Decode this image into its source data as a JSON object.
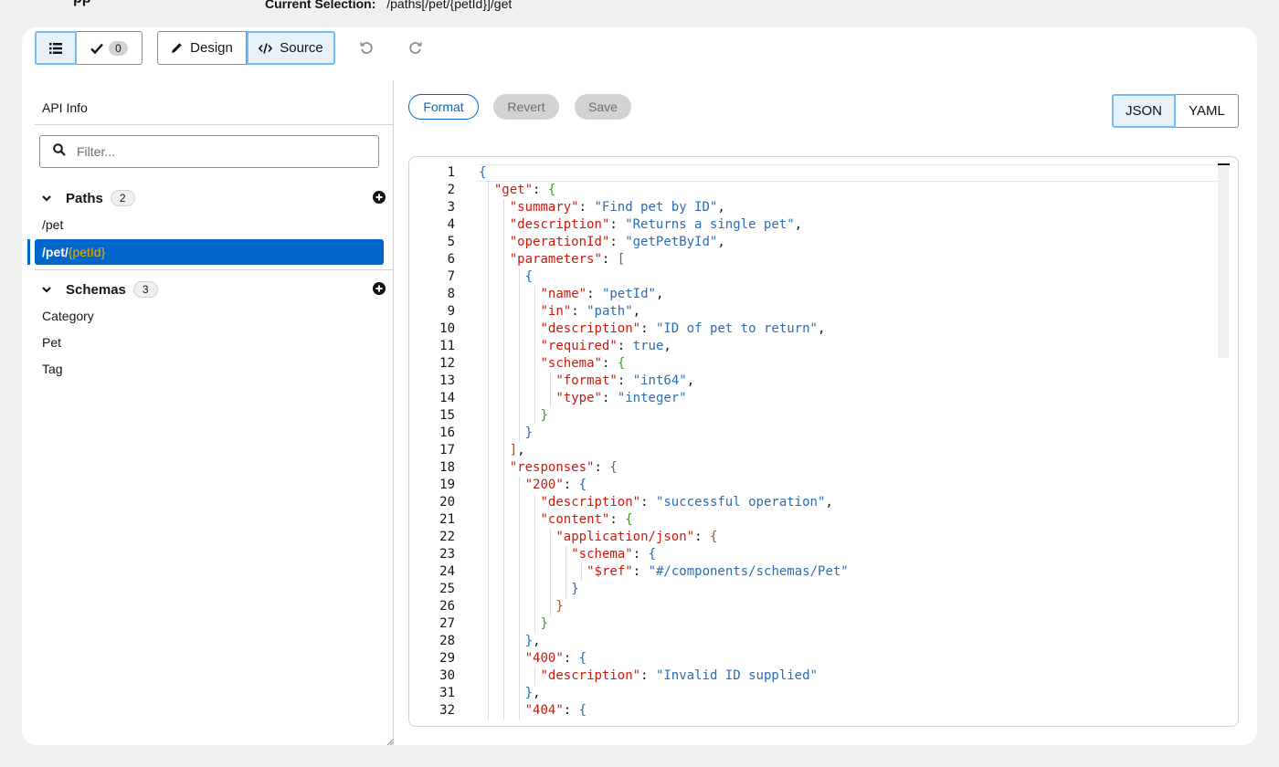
{
  "header": {
    "fragment": "pp",
    "current_selection_label": "Current Selection:",
    "current_selection_value": "/paths[/pet/{petId}]/get"
  },
  "toolbar": {
    "list_view_icon": "list-icon",
    "validation_count": "0",
    "design_label": "Design",
    "source_label": "Source",
    "undo_icon": "undo-icon",
    "redo_icon": "redo-icon"
  },
  "sidebar": {
    "api_info": "API Info",
    "filter_placeholder": "Filter...",
    "paths": {
      "title": "Paths",
      "count": "2",
      "items": [
        "/pet"
      ],
      "selected_prefix": "/pet/",
      "selected_param": "{petId}"
    },
    "schemas": {
      "title": "Schemas",
      "count": "3",
      "items": [
        "Category",
        "Pet",
        "Tag"
      ]
    }
  },
  "editor_toolbar": {
    "format_label": "Format",
    "revert_label": "Revert",
    "save_label": "Save",
    "json_label": "JSON",
    "yaml_label": "YAML",
    "active_format": "JSON"
  },
  "editor": {
    "line_numbers": [
      "1",
      "2",
      "3",
      "4",
      "5",
      "6",
      "7",
      "8",
      "9",
      "10",
      "11",
      "12",
      "13",
      "14",
      "15",
      "16",
      "17",
      "18",
      "19",
      "20",
      "21",
      "22",
      "23",
      "24",
      "25",
      "26",
      "27",
      "28",
      "29",
      "30",
      "31",
      "32"
    ],
    "lines": [
      "{",
      "  \"get\": {",
      "    \"summary\": \"Find pet by ID\",",
      "    \"description\": \"Returns a single pet\",",
      "    \"operationId\": \"getPetById\",",
      "    \"parameters\": [",
      "      {",
      "        \"name\": \"petId\",",
      "        \"in\": \"path\",",
      "        \"description\": \"ID of pet to return\",",
      "        \"required\": true,",
      "        \"schema\": {",
      "          \"format\": \"int64\",",
      "          \"type\": \"integer\"",
      "        }",
      "      }",
      "    ],",
      "    \"responses\": {",
      "      \"200\": {",
      "        \"description\": \"successful operation\",",
      "        \"content\": {",
      "          \"application/json\": {",
      "            \"schema\": {",
      "              \"$ref\": \"#/components/schemas/Pet\"",
      "            }",
      "          }",
      "        }",
      "      },",
      "      \"400\": {",
      "        \"description\": \"Invalid ID supplied\"",
      "      },",
      "      \"404\": {"
    ]
  },
  "colors": {
    "accent": "#0066cc",
    "key": "#c9190b",
    "string": "#2b6cb0",
    "param": "#f0ab00"
  }
}
